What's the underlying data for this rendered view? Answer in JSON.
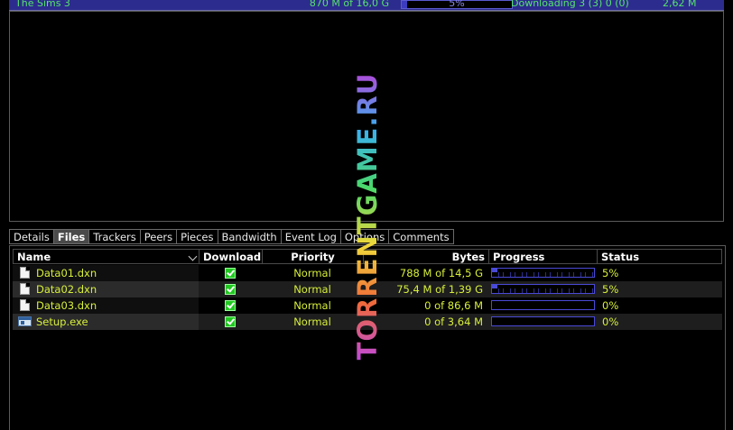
{
  "torrent_row": {
    "name": "The Sims 3",
    "size": "870 M of 16,0 G",
    "progress_label": "5%",
    "progress_fraction": 0.05,
    "status": "Downloading 3 (3) 0 (0)",
    "speed": "2,62 M"
  },
  "tabs": [
    {
      "label": "Details",
      "active": false
    },
    {
      "label": "Files",
      "active": true
    },
    {
      "label": "Trackers",
      "active": false
    },
    {
      "label": "Peers",
      "active": false
    },
    {
      "label": "Pieces",
      "active": false
    },
    {
      "label": "Bandwidth",
      "active": false
    },
    {
      "label": "Event Log",
      "active": false
    },
    {
      "label": "Options",
      "active": false
    },
    {
      "label": "Comments",
      "active": false
    }
  ],
  "columns": {
    "name": "Name",
    "download": "Download",
    "priority": "Priority",
    "bytes": "Bytes",
    "progress": "Progress",
    "status": "Status"
  },
  "files": [
    {
      "name": "Data01.dxn",
      "icon": "document-icon",
      "download": true,
      "priority": "Normal",
      "bytes": "788 M of 14,5 G",
      "progress": 0.05,
      "status": "5%"
    },
    {
      "name": "Data02.dxn",
      "icon": "document-icon",
      "download": true,
      "priority": "Normal",
      "bytes": "75,4 M of 1,39 G",
      "progress": 0.05,
      "status": "5%"
    },
    {
      "name": "Data03.dxn",
      "icon": "document-icon",
      "download": true,
      "priority": "Normal",
      "bytes": "0 of 86,6 M",
      "progress": 0,
      "status": "0%"
    },
    {
      "name": "Setup.exe",
      "icon": "executable-icon",
      "download": true,
      "priority": "Normal",
      "bytes": "0 of 3,64 M",
      "progress": 0,
      "status": "0%"
    }
  ],
  "watermark": "TORRENTGAME.RU",
  "colors": {
    "text_green": "#56e36c",
    "file_text": "#d7ef3a",
    "progress_blue": "#4a4ad8",
    "header_bar": "#2c2c8e"
  }
}
